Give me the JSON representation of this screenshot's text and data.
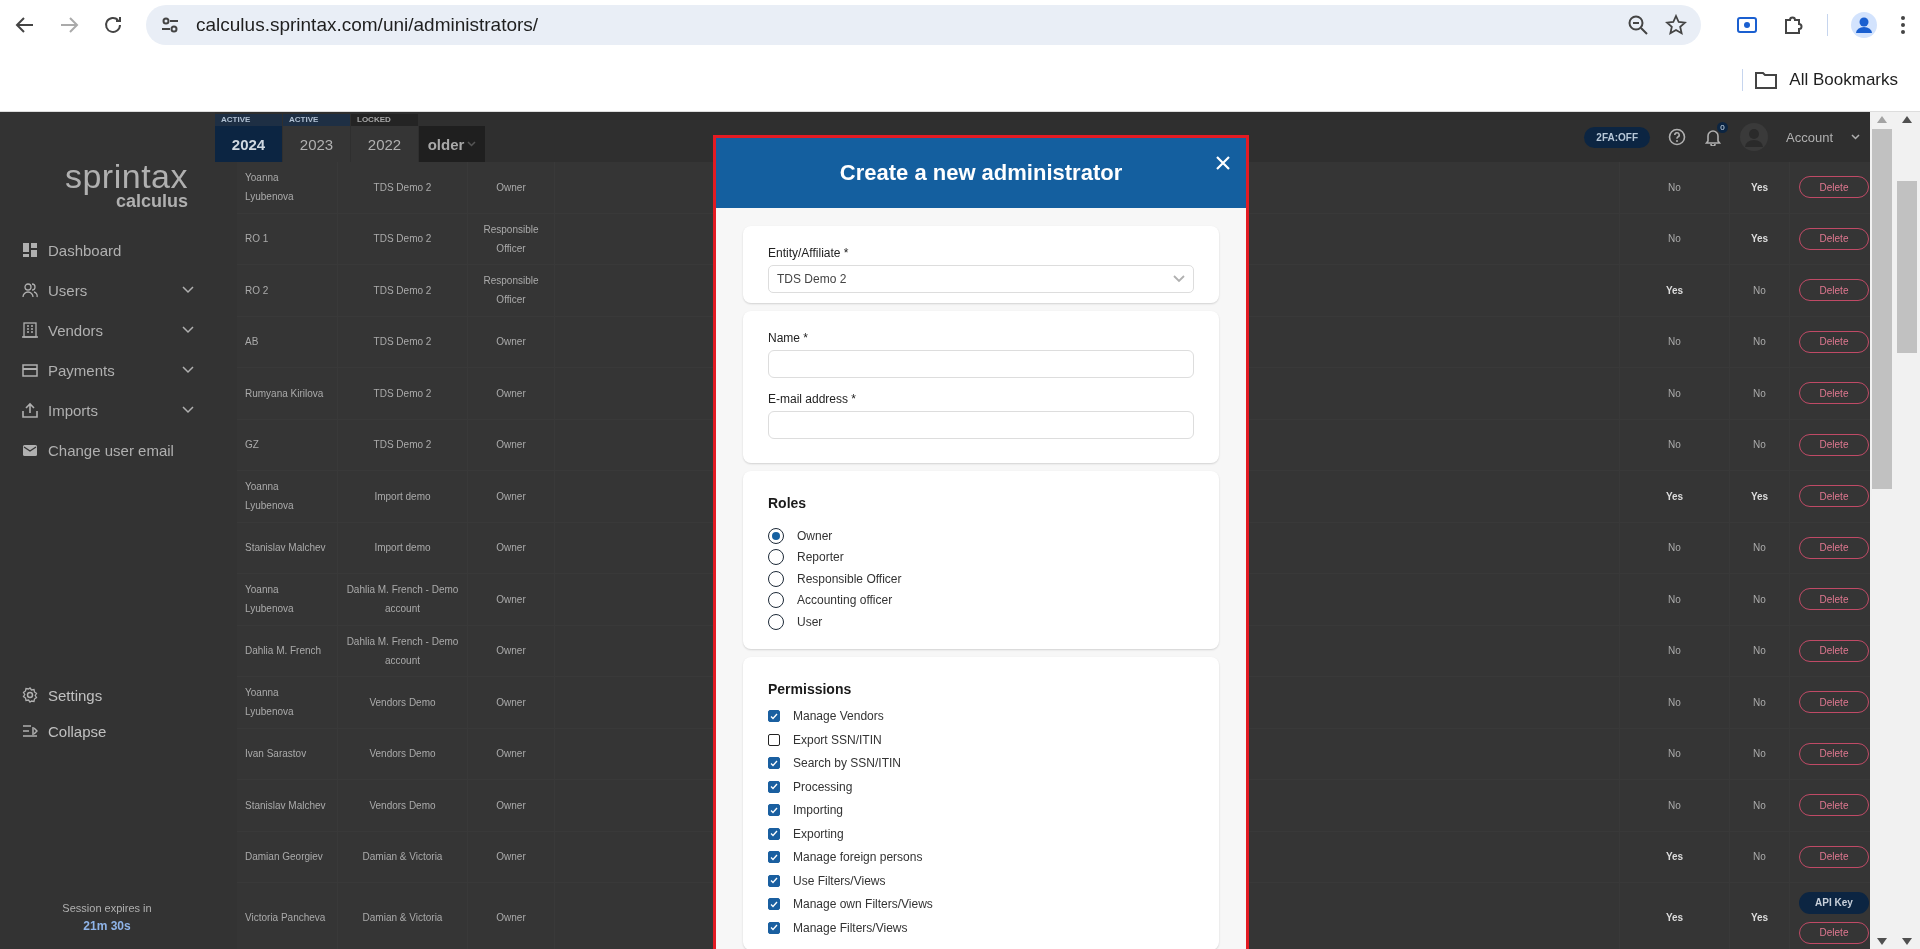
{
  "browser": {
    "url": "calculus.sprintax.com/uni/administrators/",
    "bookmarks": "All Bookmarks"
  },
  "sidebar": {
    "logo": "sprintax",
    "logo_sub": "calculus",
    "items": [
      {
        "label": "Dashboard",
        "expandable": false
      },
      {
        "label": "Users",
        "expandable": true
      },
      {
        "label": "Vendors",
        "expandable": true
      },
      {
        "label": "Payments",
        "expandable": true
      },
      {
        "label": "Imports",
        "expandable": true
      },
      {
        "label": "Change user email",
        "expandable": false
      }
    ],
    "footer_items": [
      {
        "label": "Settings"
      },
      {
        "label": "Collapse"
      }
    ],
    "session_label": "Session expires in",
    "session_time": "21m 30s"
  },
  "topbar": {
    "years": [
      {
        "status": "ACTIVE",
        "label": "2024",
        "selected": true
      },
      {
        "status": "ACTIVE",
        "label": "2023",
        "selected": false
      },
      {
        "status": "LOCKED",
        "label": "2022",
        "selected": false
      }
    ],
    "older": "older",
    "twofa": "2FA:OFF",
    "notifications": "0",
    "account": "Account"
  },
  "table": {
    "rows": [
      {
        "name": "Yoanna Lyubenova",
        "entity": "TDS Demo 2",
        "role": "Owner",
        "column_4": {
          "text": "No",
          "bold": false
        },
        "column_5": {
          "text": "Yes",
          "bold": true
        },
        "buttons": [
          {
            "kind": "delete",
            "label": "Delete"
          }
        ]
      },
      {
        "name": "RO 1",
        "entity": "TDS Demo 2",
        "role": "Responsible Officer",
        "column_4": {
          "text": "No",
          "bold": false
        },
        "column_5": {
          "text": "Yes",
          "bold": true
        },
        "buttons": [
          {
            "kind": "delete",
            "label": "Delete"
          }
        ]
      },
      {
        "name": "RO 2",
        "entity": "TDS Demo 2",
        "role": "Responsible Officer",
        "column_4": {
          "text": "Yes",
          "bold": true
        },
        "column_5": {
          "text": "No",
          "bold": false
        },
        "buttons": [
          {
            "kind": "delete",
            "label": "Delete"
          }
        ]
      },
      {
        "name": "AB",
        "entity": "TDS Demo 2",
        "role": "Owner",
        "column_4": {
          "text": "No",
          "bold": false
        },
        "column_5": {
          "text": "No",
          "bold": false
        },
        "buttons": [
          {
            "kind": "delete",
            "label": "Delete"
          }
        ]
      },
      {
        "name": "Rumyana Kirilova",
        "entity": "TDS Demo 2",
        "role": "Owner",
        "column_4": {
          "text": "No",
          "bold": false
        },
        "column_5": {
          "text": "No",
          "bold": false
        },
        "buttons": [
          {
            "kind": "delete",
            "label": "Delete"
          }
        ]
      },
      {
        "name": "GZ",
        "entity": "TDS Demo 2",
        "role": "Owner",
        "column_4": {
          "text": "No",
          "bold": false
        },
        "column_5": {
          "text": "No",
          "bold": false
        },
        "buttons": [
          {
            "kind": "delete",
            "label": "Delete"
          }
        ]
      },
      {
        "name": "Yoanna Lyubenova",
        "entity": "Import demo",
        "role": "Owner",
        "column_4": {
          "text": "Yes",
          "bold": true
        },
        "column_5": {
          "text": "Yes",
          "bold": true
        },
        "buttons": [
          {
            "kind": "delete",
            "label": "Delete"
          }
        ]
      },
      {
        "name": "Stanislav Malchev",
        "entity": "Import demo",
        "role": "Owner",
        "column_4": {
          "text": "No",
          "bold": false
        },
        "column_5": {
          "text": "No",
          "bold": false
        },
        "buttons": [
          {
            "kind": "delete",
            "label": "Delete"
          }
        ]
      },
      {
        "name": "Yoanna Lyubenova",
        "entity": "Dahlia M. French - Demo account",
        "role": "Owner",
        "column_4": {
          "text": "No",
          "bold": false
        },
        "column_5": {
          "text": "No",
          "bold": false
        },
        "buttons": [
          {
            "kind": "delete",
            "label": "Delete"
          }
        ]
      },
      {
        "name": "Dahlia M. French",
        "entity": "Dahlia M. French - Demo account",
        "role": "Owner",
        "column_4": {
          "text": "No",
          "bold": false
        },
        "column_5": {
          "text": "No",
          "bold": false
        },
        "buttons": [
          {
            "kind": "delete",
            "label": "Delete"
          }
        ]
      },
      {
        "name": "Yoanna Lyubenova",
        "entity": "Vendors Demo",
        "role": "Owner",
        "column_4": {
          "text": "No",
          "bold": false
        },
        "column_5": {
          "text": "No",
          "bold": false
        },
        "buttons": [
          {
            "kind": "delete",
            "label": "Delete"
          }
        ]
      },
      {
        "name": "Ivan Sarastov",
        "entity": "Vendors Demo",
        "role": "Owner",
        "column_4": {
          "text": "No",
          "bold": false
        },
        "column_5": {
          "text": "No",
          "bold": false
        },
        "buttons": [
          {
            "kind": "delete",
            "label": "Delete"
          }
        ]
      },
      {
        "name": "Stanislav Malchev",
        "entity": "Vendors Demo",
        "role": "Owner",
        "column_4": {
          "text": "No",
          "bold": false
        },
        "column_5": {
          "text": "No",
          "bold": false
        },
        "buttons": [
          {
            "kind": "delete",
            "label": "Delete"
          }
        ]
      },
      {
        "name": "Damian Georgiev",
        "entity": "Damian & Victoria",
        "role": "Owner",
        "column_4": {
          "text": "Yes",
          "bold": true
        },
        "column_5": {
          "text": "No",
          "bold": false
        },
        "buttons": [
          {
            "kind": "delete",
            "label": "Delete"
          }
        ]
      },
      {
        "name": "Victoria Pancheva",
        "entity": "Damian & Victoria",
        "role": "Owner",
        "column_4": {
          "text": "Yes",
          "bold": true
        },
        "column_5": {
          "text": "Yes",
          "bold": true
        },
        "buttons": [
          {
            "kind": "primary",
            "label": "API Key"
          },
          {
            "kind": "delete",
            "label": "Delete"
          }
        ]
      }
    ]
  },
  "modal": {
    "title": "Create a new administrator",
    "entity": {
      "label": "Entity/Affiliate *",
      "value": "TDS Demo 2"
    },
    "name": {
      "label": "Name *"
    },
    "email": {
      "label": "E-mail address *"
    },
    "roles": {
      "title": "Roles",
      "options": [
        {
          "label": "Owner",
          "selected": true
        },
        {
          "label": "Reporter",
          "selected": false
        },
        {
          "label": "Responsible Officer",
          "selected": false
        },
        {
          "label": "Accounting officer",
          "selected": false
        },
        {
          "label": "User",
          "selected": false
        }
      ]
    },
    "permissions": {
      "title": "Permissions",
      "options": [
        {
          "label": "Manage Vendors",
          "checked": true
        },
        {
          "label": "Export SSN/ITIN",
          "checked": false
        },
        {
          "label": "Search by SSN/ITIN",
          "checked": true
        },
        {
          "label": "Processing",
          "checked": true
        },
        {
          "label": "Importing",
          "checked": true
        },
        {
          "label": "Exporting",
          "checked": true
        },
        {
          "label": "Manage foreign persons",
          "checked": true
        },
        {
          "label": "Use Filters/Views",
          "checked": true
        },
        {
          "label": "Manage own Filters/Views",
          "checked": true
        },
        {
          "label": "Manage Filters/Views",
          "checked": true
        }
      ]
    }
  }
}
